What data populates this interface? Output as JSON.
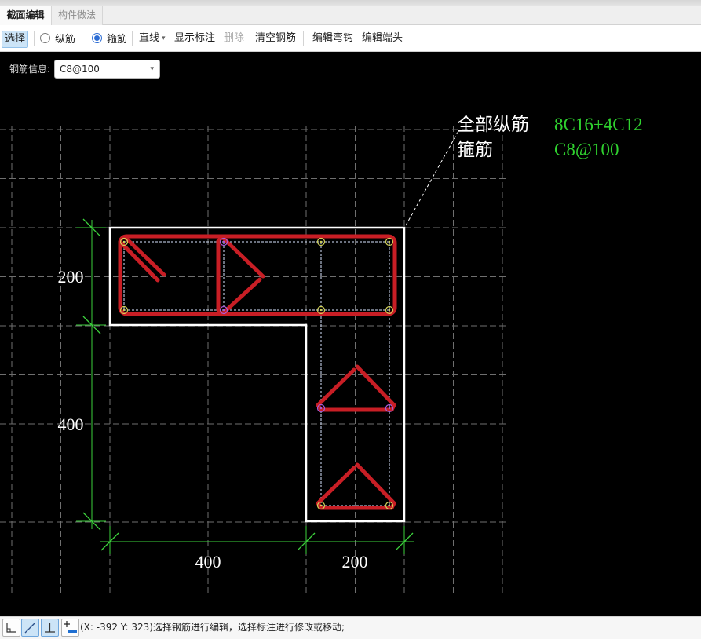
{
  "tabs": [
    {
      "label": "截面编辑",
      "active": true
    },
    {
      "label": "构件做法",
      "active": false
    }
  ],
  "toolbar": {
    "select_label": "选择",
    "rebar_type_options": [
      {
        "label": "纵筋",
        "checked": false
      },
      {
        "label": "箍筋",
        "checked": true
      }
    ],
    "draw_mode_label": "直线",
    "draw_mode_icon": "caret-down-icon",
    "show_dimension_label": "显示标注",
    "delete_label": "删除",
    "delete_enabled": false,
    "clear_rebar_label": "清空钢筋",
    "edit_hook_label": "编辑弯钩",
    "edit_end_label": "编辑端头"
  },
  "rebar_info": {
    "label": "钢筋信息:",
    "selected_value": "C8@100",
    "dropdown_icon": "dropdown-arrow-icon"
  },
  "section": {
    "dimensions": {
      "vertical": [
        "200",
        "400"
      ],
      "horizontal": [
        "400",
        "200"
      ]
    },
    "annotation": [
      {
        "name": "全部纵筋",
        "value": "8C16+4C12"
      },
      {
        "name": "箍筋",
        "value": "C8@100"
      }
    ]
  },
  "status_bar": {
    "tools": [
      {
        "icon": "angle-icon",
        "active": false
      },
      {
        "icon": "diagonal-line-icon",
        "active": true
      },
      {
        "icon": "perpendicular-icon",
        "active": true
      },
      {
        "icon": "add-point-icon",
        "active": false
      }
    ],
    "coordinates": "(X: -392 Y: 323)",
    "message": "选择钢筋进行编辑，选择标注进行修改或移动;"
  },
  "colors": {
    "canvas_bg": "#000000",
    "grid": "#6f6f6f",
    "section_outline": "#ffffff",
    "stirrup": "#c81e25",
    "dimension": "#3cd23c",
    "annotation_value": "#2fd22f",
    "corner_rebar": "#d2d25a",
    "tie_rebar": "#a85cd8",
    "rebar_guide": "#d8e4ff",
    "selected_button": "#cce4f7"
  }
}
